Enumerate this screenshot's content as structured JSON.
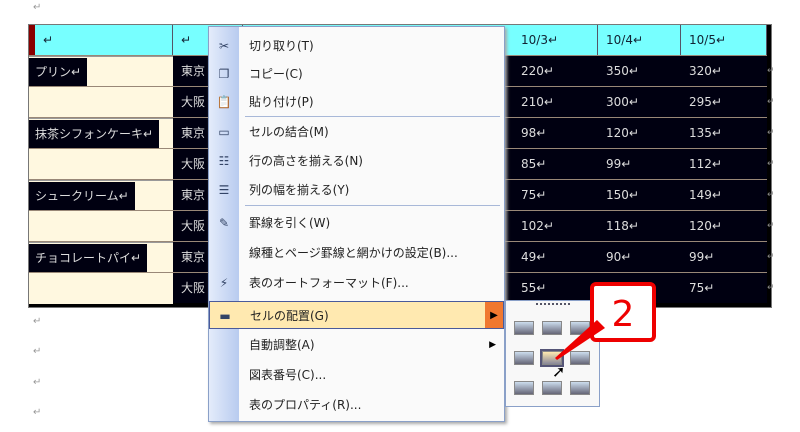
{
  "table": {
    "headers": [
      "↵",
      "↵",
      "",
      "",
      "",
      "10/3↵",
      "10/4↵",
      "10/5↵"
    ],
    "rows": [
      {
        "name": "プリン↵",
        "city": "東京",
        "v": [
          "220↵",
          "350↵",
          "320↵"
        ]
      },
      {
        "name": "",
        "city": "大阪",
        "v": [
          "210↵",
          "300↵",
          "295↵"
        ]
      },
      {
        "name": "抹茶シフォンケーキ↵",
        "city": "東京",
        "v": [
          "98↵",
          "120↵",
          "135↵"
        ]
      },
      {
        "name": "",
        "city": "大阪",
        "v": [
          "85↵",
          "99↵",
          "112↵"
        ]
      },
      {
        "name": "シュークリーム↵",
        "city": "東京",
        "v": [
          "75↵",
          "150↵",
          "149↵"
        ]
      },
      {
        "name": "",
        "city": "大阪",
        "v": [
          "102↵",
          "118↵",
          "120↵"
        ]
      },
      {
        "name": "チョコレートパイ↵",
        "city": "東京",
        "v": [
          "49↵",
          "90↵",
          "99↵"
        ]
      },
      {
        "name": "",
        "city": "大阪",
        "v": [
          "55↵",
          "",
          "75↵"
        ]
      }
    ]
  },
  "paragraph_mark": "↵",
  "menu": {
    "items": [
      {
        "label": "切り取り(T)",
        "icon": "scissors-icon",
        "glyph": "✂"
      },
      {
        "label": "コピー(C)",
        "icon": "copy-icon",
        "glyph": "❐"
      },
      {
        "label": "貼り付け(P)",
        "icon": "paste-icon",
        "glyph": "📋"
      },
      {
        "label": "セルの結合(M)",
        "icon": "merge-cells-icon",
        "glyph": "▭"
      },
      {
        "label": "行の高さを揃える(N)",
        "icon": "distribute-rows-icon",
        "glyph": "☷"
      },
      {
        "label": "列の幅を揃える(Y)",
        "icon": "distribute-columns-icon",
        "glyph": "☰"
      },
      {
        "label": "罫線を引く(W)",
        "icon": "draw-table-icon",
        "glyph": "✎"
      },
      {
        "label": "線種とページ罫線と網かけの設定(B)...",
        "icon": "",
        "glyph": ""
      },
      {
        "label": "表のオートフォーマット(F)...",
        "icon": "autoformat-icon",
        "glyph": "⚡"
      },
      {
        "label": "セルの配置(G)",
        "icon": "cell-alignment-icon",
        "glyph": "▬"
      },
      {
        "label": "自動調整(A)",
        "icon": "",
        "glyph": ""
      },
      {
        "label": "図表番号(C)...",
        "icon": "",
        "glyph": ""
      },
      {
        "label": "表のプロパティ(R)...",
        "icon": "",
        "glyph": ""
      }
    ],
    "submenu_arrow": "▶"
  },
  "callout": "2"
}
